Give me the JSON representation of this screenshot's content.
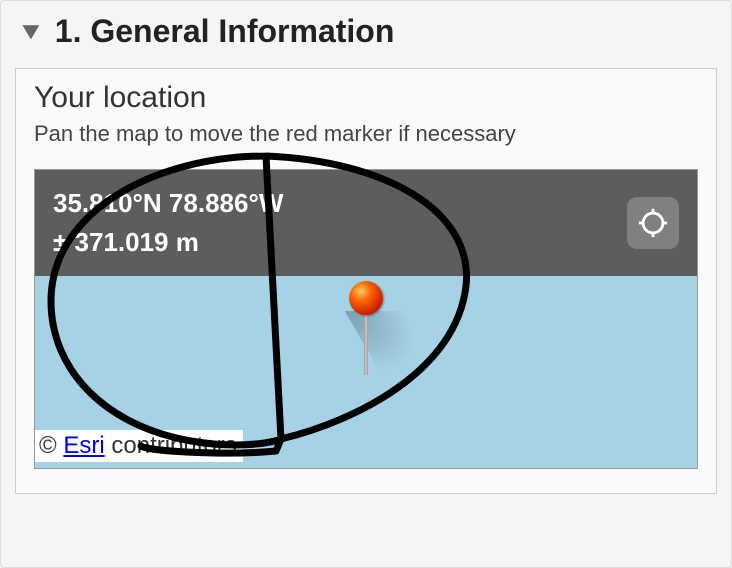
{
  "section": {
    "title": "1. General Information",
    "expanded": true
  },
  "location": {
    "label": "Your location",
    "hint": "Pan the map to move the red marker if necessary",
    "coords_line": "35.810°N 78.886°W",
    "accuracy_line": "± 371.019 m"
  },
  "attribution": {
    "prefix": "© ",
    "link_text": "Esri",
    "suffix": " contributors"
  },
  "icons": {
    "collapse": "chevron-down",
    "locate": "crosshair",
    "marker": "map-pin"
  },
  "colors": {
    "coords_bar": "#5d5d5d",
    "map_bg": "#a6d2e6",
    "marker": "#ff5500"
  }
}
